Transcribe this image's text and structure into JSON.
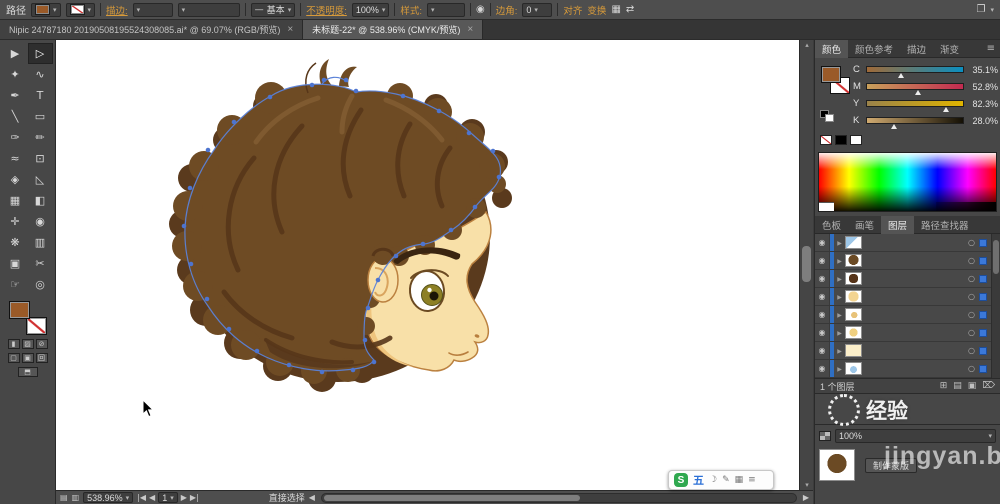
{
  "top_bar": {
    "selection_label": "路径",
    "stroke_label": "描边:",
    "brush_value": "基本",
    "opacity_label": "不透明度:",
    "opacity_value": "100%",
    "style_label": "样式:",
    "corner_label": "边角:",
    "corner_value": "0",
    "align_label": "对齐",
    "transform_label": "变换"
  },
  "tab_bar": {
    "tabs": [
      {
        "title": "Nipic 24787180 20190508195524308085.ai* @ 69.07% (RGB/预览)"
      },
      {
        "title": "未标题-22* @ 538.96% (CMYK/预览)"
      }
    ]
  },
  "tools": [
    {
      "name": "selection",
      "glyph": "▶"
    },
    {
      "name": "direct-selection",
      "glyph": "▷"
    },
    {
      "name": "magic-wand",
      "glyph": "✦"
    },
    {
      "name": "lasso",
      "glyph": "∿"
    },
    {
      "name": "pen",
      "glyph": "✒"
    },
    {
      "name": "type",
      "glyph": "T"
    },
    {
      "name": "line-segment",
      "glyph": "╲"
    },
    {
      "name": "rectangle",
      "glyph": "▭"
    },
    {
      "name": "paintbrush",
      "glyph": "✑"
    },
    {
      "name": "pencil",
      "glyph": "✏"
    },
    {
      "name": "width",
      "glyph": "≈"
    },
    {
      "name": "free-transform",
      "glyph": "⊡"
    },
    {
      "name": "shape-builder",
      "glyph": "◈"
    },
    {
      "name": "perspective-grid",
      "glyph": "◺"
    },
    {
      "name": "mesh",
      "glyph": "▦"
    },
    {
      "name": "gradient",
      "glyph": "◧"
    },
    {
      "name": "eyedropper",
      "glyph": "✛"
    },
    {
      "name": "blend",
      "glyph": "◉"
    },
    {
      "name": "symbol-sprayer",
      "glyph": "❋"
    },
    {
      "name": "column-graph",
      "glyph": "▥"
    },
    {
      "name": "artboard",
      "glyph": "▣"
    },
    {
      "name": "slice",
      "glyph": "✂"
    },
    {
      "name": "hand",
      "glyph": "☞"
    },
    {
      "name": "zoom",
      "glyph": "◎"
    }
  ],
  "panels": {
    "color": {
      "tabs": [
        "颜色",
        "颜色参考",
        "描边",
        "渐变"
      ],
      "sliders": [
        {
          "label": "C",
          "value": "35.1%",
          "percent": 35
        },
        {
          "label": "M",
          "value": "52.8%",
          "percent": 53
        },
        {
          "label": "Y",
          "value": "82.3%",
          "percent": 82
        },
        {
          "label": "K",
          "value": "28.0%",
          "percent": 28
        }
      ]
    },
    "layers": {
      "tabs": [
        "色板",
        "画笔",
        "图层",
        "路径查找器"
      ],
      "footer": "1 个图层",
      "row_count": 8
    },
    "transparency": {
      "opacity_value": "100%",
      "make_mask_label": "制作蒙版"
    }
  },
  "status_bar": {
    "zoom": "538.96%",
    "page_number": "1",
    "tool_name": "直接选择"
  },
  "ime_bar": {
    "logo": "S",
    "mode": "五"
  },
  "watermark": {
    "logo_text": "经验",
    "site_text": "jingyan.ba"
  },
  "colors": {
    "fill_brown": "#9a5a28",
    "hair_brown": "#6e4b24",
    "hair_dark": "#5a3a1d",
    "skin": "#f8e0a8",
    "anchor_blue": "#4d74cf",
    "selection_blue": "#2f6fc4",
    "link_orange": "#d79a3a"
  }
}
